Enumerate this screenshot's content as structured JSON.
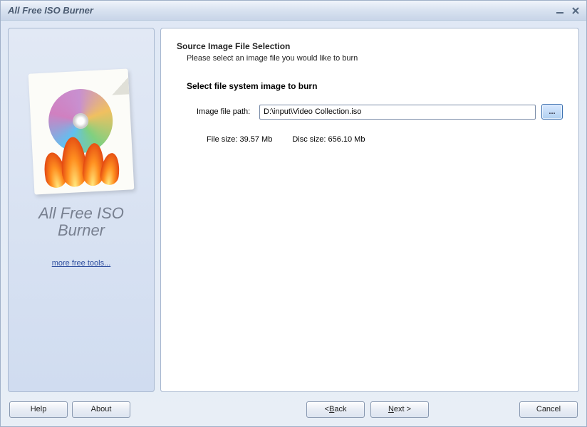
{
  "window": {
    "title": "All Free ISO Burner"
  },
  "sidebar": {
    "app_name_line1": "All Free ISO",
    "app_name_line2": "Burner",
    "more_tools": "more free tools..."
  },
  "main": {
    "section_title": "Source Image File Selection",
    "section_subtitle": "Please select an image file you would like to burn",
    "subsection_title": "Select file system image to burn",
    "field_label": "Image file path:",
    "file_path": "D:\\input\\Video Collection.iso",
    "browse_label": "...",
    "file_size_label": "File size:",
    "file_size_value": "39.57 Mb",
    "disc_size_label": "Disc size:",
    "disc_size_value": "656.10 Mb"
  },
  "buttons": {
    "help": "Help",
    "about": "About",
    "back_prefix": "< ",
    "back_letter": "B",
    "back_rest": "ack",
    "next_letter": "N",
    "next_rest": "ext >",
    "cancel": "Cancel"
  }
}
